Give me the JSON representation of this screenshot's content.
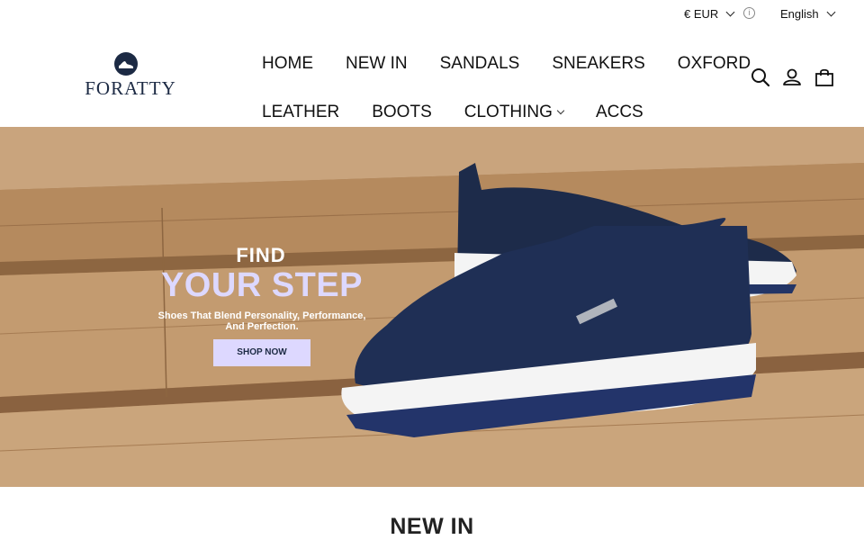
{
  "topbar": {
    "currency": "€ EUR",
    "language": "English"
  },
  "logo": {
    "text": "FORATTY"
  },
  "nav": {
    "row1": [
      "HOME",
      "NEW IN",
      "SANDALS",
      "SNEAKERS",
      "OXFORD"
    ],
    "row2": [
      "LEATHER",
      "BOOTS",
      "CLOTHING",
      "ACCS"
    ]
  },
  "icons": {
    "search": "search-icon",
    "account": "user-icon",
    "cart": "shopping-bag-icon"
  },
  "hero": {
    "kicker": "FIND",
    "title": "YOUR STEP",
    "subtitle_line1": "Shoes That Blend Personality, Performance,",
    "subtitle_line2": "And Perfection.",
    "button": "SHOP NOW"
  },
  "section": {
    "title": "NEW IN"
  },
  "colors": {
    "navy": "#1c2a44",
    "lavender": "#ddd8ff",
    "wood": "#b58a5e"
  }
}
